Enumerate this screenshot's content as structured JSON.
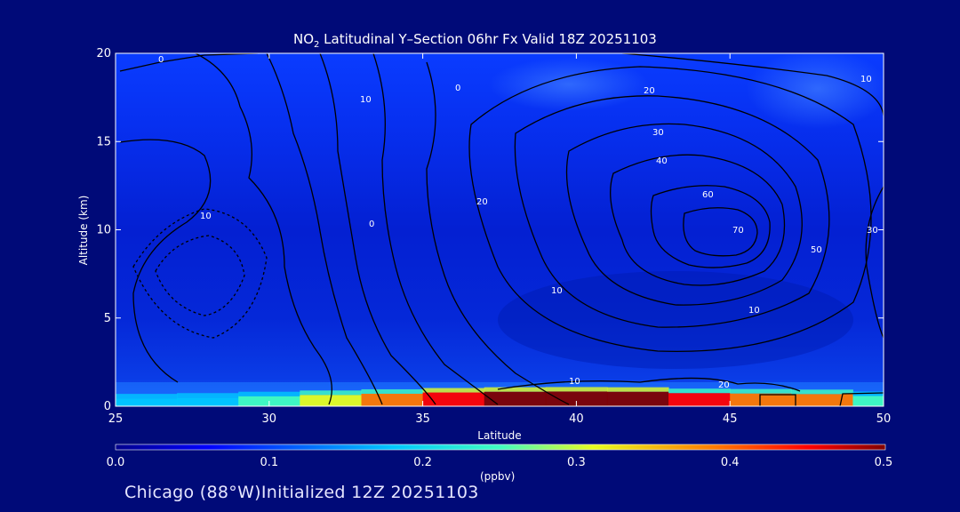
{
  "chart_data": {
    "type": "heatmap",
    "title_prefix": "NO",
    "title_subscript": "2",
    "title_suffix": " Latitudinal Y–Section 06hr  Fx Valid 18Z 20251103",
    "xlabel": "Latitude",
    "ylabel": "Altitude (km)",
    "xlim": [
      25,
      50
    ],
    "ylim": [
      0,
      20
    ],
    "x_ticks": [
      "25",
      "30",
      "35",
      "40",
      "45",
      "50"
    ],
    "y_ticks": [
      "0",
      "5",
      "10",
      "15",
      "20"
    ],
    "colorbar": {
      "min": 0.0,
      "max": 0.5,
      "ticks": [
        "0.0",
        "0.1",
        "0.2",
        "0.3",
        "0.4",
        "0.5"
      ],
      "units": "(ppbv)"
    },
    "surface_layer": {
      "altitude_km": [
        0,
        0.5,
        1,
        1.5
      ],
      "latitude": [
        25,
        27,
        29,
        31,
        33,
        35,
        37,
        39,
        41,
        43,
        45,
        47,
        49,
        50
      ],
      "no2_ppbv_at_surface": [
        0.12,
        0.14,
        0.2,
        0.28,
        0.33,
        0.4,
        0.46,
        0.48,
        0.48,
        0.46,
        0.34,
        0.42,
        0.28,
        0.22
      ]
    },
    "contours": {
      "levels": [
        0,
        10,
        20,
        30,
        40,
        50,
        60,
        70
      ],
      "labeled_values": [
        "0",
        "10",
        "20",
        "30",
        "40",
        "50",
        "60",
        "70"
      ],
      "max_center": {
        "latitude": 45.5,
        "altitude_km": 9.8,
        "value": 70
      }
    }
  },
  "footer": {
    "text": "Chicago (88°W)Initialized 12Z 20251103"
  }
}
